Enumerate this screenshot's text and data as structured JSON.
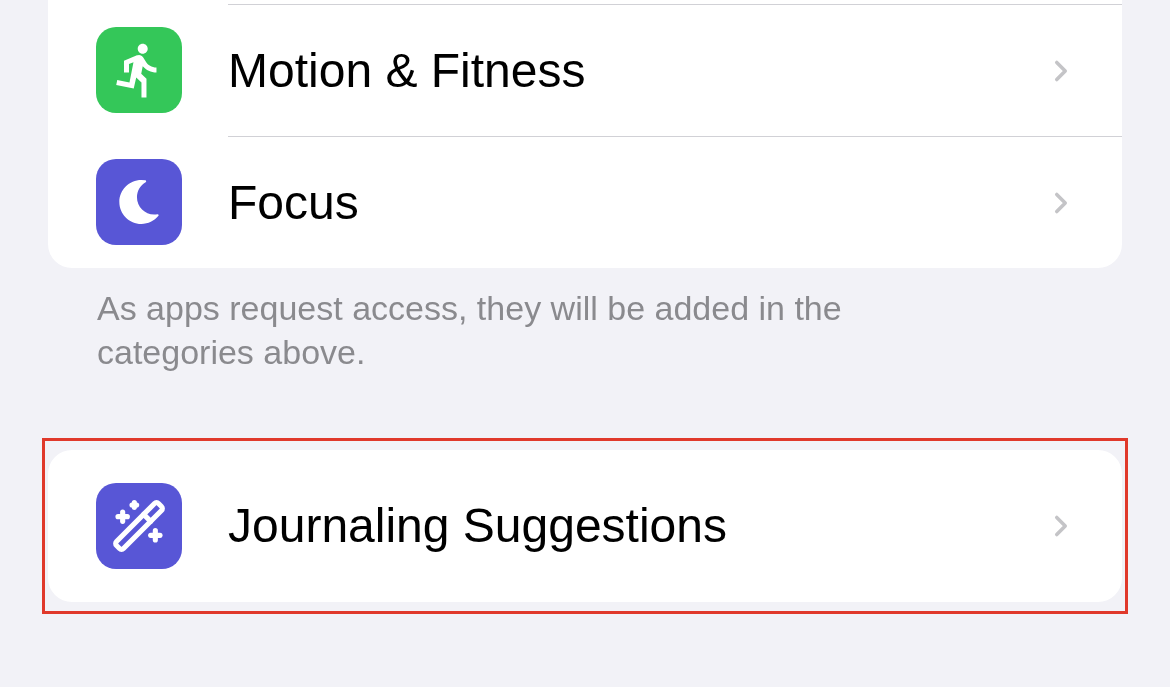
{
  "groups": [
    {
      "highlighted": false,
      "rows": [
        {
          "kind": "fitness",
          "label": "Motion & Fitness",
          "color": "#34c759"
        },
        {
          "kind": "focus",
          "label": "Focus",
          "color": "#5856d6"
        }
      ],
      "footer": "As apps request access, they will be added in the categories above."
    },
    {
      "highlighted": true,
      "rows": [
        {
          "kind": "journal",
          "label": "Journaling Suggestions",
          "color": "#5856d6"
        }
      ]
    }
  ]
}
